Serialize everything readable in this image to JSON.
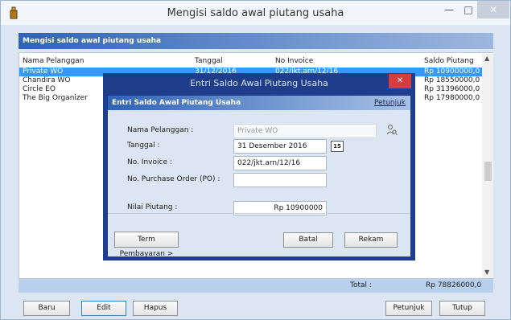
{
  "window": {
    "title": "Mengisi saldo awal piutang usaha"
  },
  "header": {
    "title": "Mengisi saldo awal piutang usaha"
  },
  "table": {
    "columns": [
      "Nama Pelanggan",
      "Tanggal",
      "No Invoice",
      "Saldo Piutang"
    ],
    "rows": [
      {
        "nama": "Private WO",
        "tanggal": "31/12/2016",
        "invoice": "022/jkt.arn/12/16",
        "saldo": "Rp 10900000,0"
      },
      {
        "nama": "Chandira WO",
        "tanggal": "",
        "invoice": "",
        "saldo": "Rp 18550000,0"
      },
      {
        "nama": "Circle EO",
        "tanggal": "",
        "invoice": "",
        "saldo": "Rp 31396000,0"
      },
      {
        "nama": "The Big Organizer",
        "tanggal": "",
        "invoice": "",
        "saldo": "Rp 17980000,0"
      }
    ],
    "total_label": "Total :",
    "total_value": "Rp 78826000,0"
  },
  "buttons": {
    "baru": "Baru",
    "edit": "Edit",
    "hapus": "Hapus",
    "petunjuk": "Petunjuk",
    "tutup": "Tutup"
  },
  "dialog": {
    "title": "Entri Saldo Awal Piutang Usaha",
    "header": "Entri Saldo Awal Piutang Usaha",
    "help": "Petunjuk",
    "fields": {
      "nama_label": "Nama Pelanggan :",
      "nama_value": "Private WO",
      "tanggal_label": "Tanggal :",
      "tanggal_value": "31 Desember 2016",
      "calendar_text": "15",
      "invoice_label": "No. Invoice :",
      "invoice_value": "022/jkt.arn/12/16",
      "po_label": "No. Purchase Order (PO) :",
      "po_value": "",
      "nilai_label": "Nilai Piutang :",
      "nilai_value": "Rp 10900000"
    },
    "buttons": {
      "term": "Term Pembayaran >",
      "batal": "Batal",
      "rekam": "Rekam"
    }
  },
  "colors": {
    "accent": "#2f63b6",
    "selection": "#3399ff",
    "dialog_frame": "#1f3d8a",
    "close_red": "#d83b3b"
  },
  "icons": {
    "app": "bucket-icon",
    "lookup": "people-search-icon",
    "calendar": "calendar-icon"
  }
}
